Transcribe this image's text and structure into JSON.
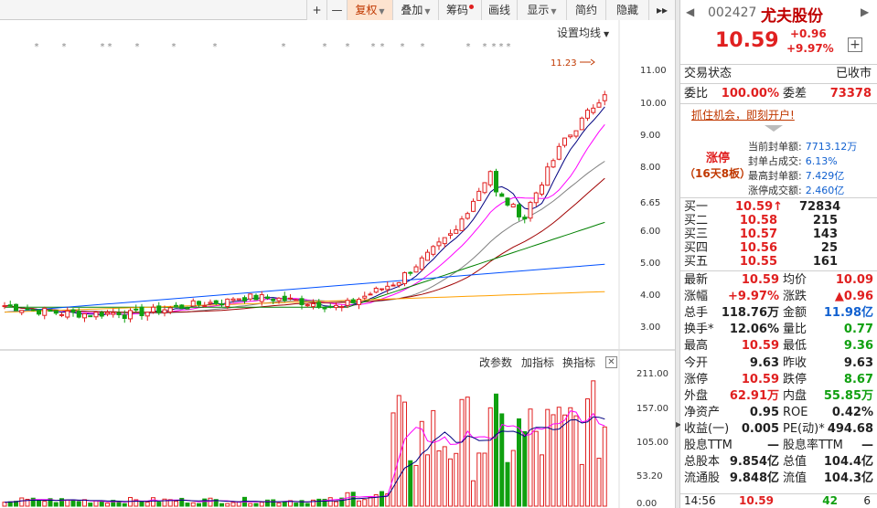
{
  "toolbar": {
    "plus": "+",
    "minus": "—",
    "fuquan": "复权",
    "diejia": "叠加",
    "chouma": "筹码",
    "huaxian": "画线",
    "xianshi": "显示",
    "jianyue": "简约",
    "yincang": "隐藏",
    "more": "▸▸"
  },
  "chart": {
    "settings_label": "设置均线",
    "peak_label": "11.23",
    "price_ticks": [
      "11.00",
      "10.00",
      "9.00",
      "8.00",
      "6.65",
      "6.00",
      "5.00",
      "4.00",
      "3.00"
    ],
    "volume_ticks": [
      "211.00",
      "157.00",
      "105.00",
      "53.20",
      "0.00"
    ],
    "indicator_links": {
      "change_params": "改参数",
      "add_indicator": "加指标",
      "switch_indicator": "换指标",
      "close": "✕"
    },
    "colors": {
      "up": "#e02020",
      "down": "#10a010",
      "ma5": "#000080",
      "ma10": "#ff00ff",
      "ma20": "#808080",
      "ma30": "#a00000",
      "ma60": "#008000",
      "ma120": "#0050ff",
      "ma250": "#ffa000"
    }
  },
  "panel": {
    "code": "002427",
    "name": "尤夫股份",
    "price": "10.59",
    "change": "+0.96",
    "change_pct": "+9.97%",
    "add_button": "+",
    "trade_status_label": "交易状态",
    "trade_status_value": "已收市",
    "weibi_label": "委比",
    "weibi_value": "100.00%",
    "weicha_label": "委差",
    "weicha_value": "73378",
    "promo": "抓住机会，即刻开户!",
    "limit_up": {
      "title": "涨停",
      "subtitle": "（16天8板）",
      "items": [
        {
          "label": "当前封单额:",
          "value": "7713.12万"
        },
        {
          "label": "封单占成交:",
          "value": "6.13%"
        },
        {
          "label": "最高封单额:",
          "value": "7.429亿"
        },
        {
          "label": "涨停成交额:",
          "value": "2.460亿"
        }
      ]
    },
    "bids": [
      {
        "label": "买一",
        "price": "10.59↑",
        "vol": "72834"
      },
      {
        "label": "买二",
        "price": "10.58",
        "vol": "215"
      },
      {
        "label": "买三",
        "price": "10.57",
        "vol": "143"
      },
      {
        "label": "买四",
        "price": "10.56",
        "vol": "25"
      },
      {
        "label": "买五",
        "price": "10.55",
        "vol": "161"
      }
    ],
    "stats": [
      {
        "l1": "最新",
        "v1": "10.59",
        "c1": "red",
        "l2": "均价",
        "v2": "10.09",
        "c2": "red"
      },
      {
        "l1": "涨幅",
        "v1": "+9.97%",
        "c1": "red",
        "l2": "涨跌",
        "v2": "▲0.96",
        "c2": "red"
      },
      {
        "l1": "总手",
        "v1": "118.76万",
        "c1": "black",
        "l2": "金额",
        "v2": "11.98亿",
        "c2": "blue"
      },
      {
        "l1": "换手*",
        "v1": "12.06%",
        "c1": "black",
        "l2": "量比",
        "v2": "0.77",
        "c2": "green"
      },
      {
        "l1": "最高",
        "v1": "10.59",
        "c1": "red",
        "l2": "最低",
        "v2": "9.36",
        "c2": "green"
      },
      {
        "l1": "今开",
        "v1": "9.63",
        "c1": "black",
        "l2": "昨收",
        "v2": "9.63",
        "c2": "black"
      },
      {
        "l1": "涨停",
        "v1": "10.59",
        "c1": "red",
        "l2": "跌停",
        "v2": "8.67",
        "c2": "green"
      },
      {
        "l1": "外盘",
        "v1": "62.91万",
        "c1": "red",
        "l2": "内盘",
        "v2": "55.85万",
        "c2": "green"
      },
      {
        "l1": "净资产",
        "v1": "0.95",
        "c1": "black",
        "l2": "ROE",
        "v2": "0.42%",
        "c2": "black"
      },
      {
        "l1": "收益(一)",
        "v1": "0.005",
        "c1": "black",
        "l2": "PE(动)*",
        "v2": "494.68",
        "c2": "black"
      },
      {
        "l1": "股息TTM",
        "v1": "—",
        "c1": "black",
        "l2": "股息率TTM",
        "v2": "—",
        "c2": "black"
      },
      {
        "l1": "总股本",
        "v1": "9.854亿",
        "c1": "black",
        "l2": "总值",
        "v2": "104.4亿",
        "c2": "black"
      },
      {
        "l1": "流通股",
        "v1": "9.848亿",
        "c1": "black",
        "l2": "流值",
        "v2": "104.3亿",
        "c2": "black"
      }
    ],
    "tick": {
      "time": "14:56",
      "price": "10.59",
      "vol": "42",
      "num": "6"
    }
  }
}
